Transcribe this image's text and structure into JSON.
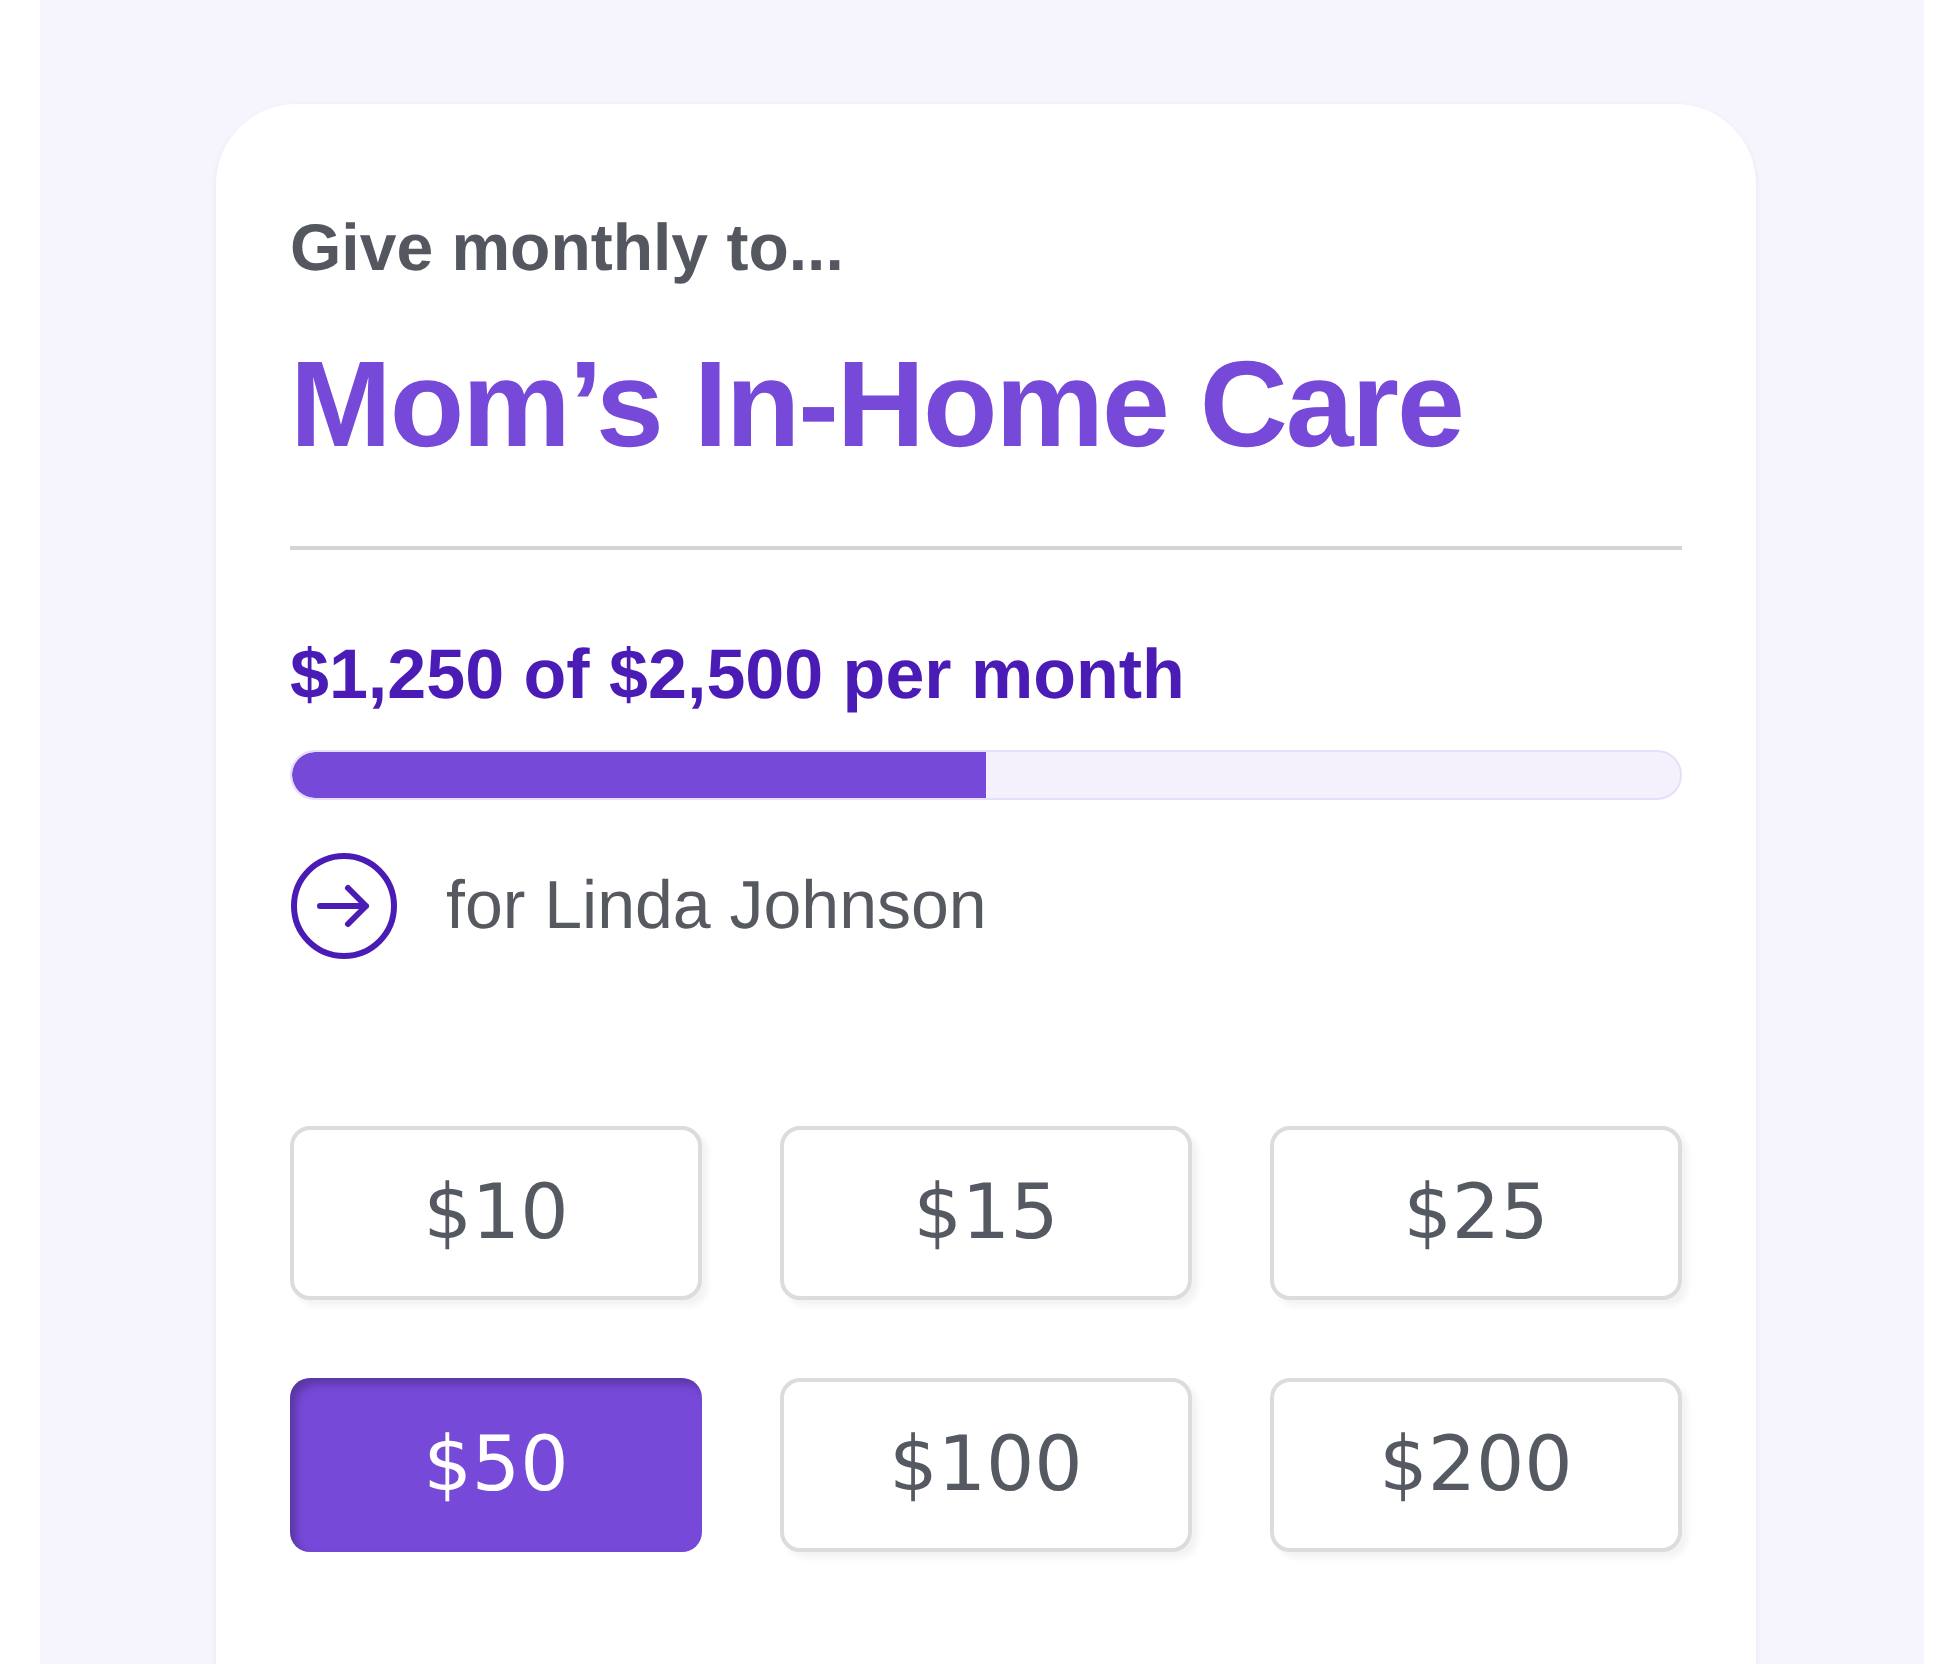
{
  "intro": "Give monthly to...",
  "title": "Mom’s In-Home Care",
  "progress": {
    "text": "$1,250 of $2,500 per month",
    "level": 0.5
  },
  "recipient": "for Linda Johnson",
  "amounts": [
    {
      "label": "$10",
      "selected": false
    },
    {
      "label": "$15",
      "selected": false
    },
    {
      "label": "$25",
      "selected": false
    },
    {
      "label": "$50",
      "selected": true
    },
    {
      "label": "$100",
      "selected": false
    },
    {
      "label": "$200",
      "selected": false
    }
  ]
}
